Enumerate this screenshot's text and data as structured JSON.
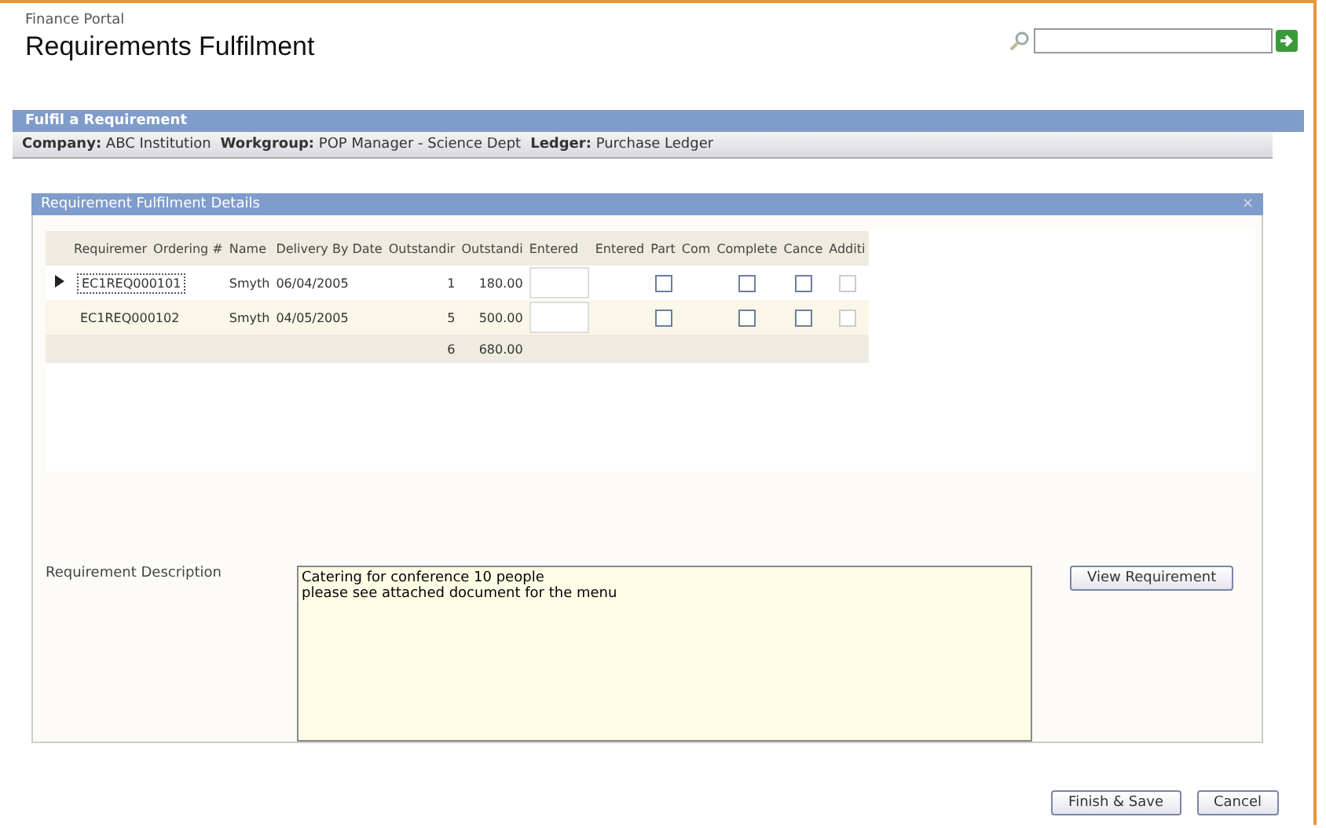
{
  "header": {
    "portal": "Finance Portal",
    "title": "Requirements Fulfilment"
  },
  "section": {
    "title": "Fulfil a Requirement",
    "info": [
      {
        "label": "Company:",
        "value": "ABC Institution"
      },
      {
        "label": "Workgroup:",
        "value": "POP Manager - Science Dept"
      },
      {
        "label": "Ledger:",
        "value": "Purchase Ledger"
      }
    ]
  },
  "panel": {
    "title": "Requirement Fulfilment Details",
    "close": "×",
    "columns": [
      "Requiremer",
      "Ordering #",
      "Name",
      "Delivery By Date",
      "Outstandir",
      "Outstandi",
      "Entered",
      "Entered",
      "Part",
      "Com",
      "Complete",
      "Cance",
      "Additi"
    ],
    "rows": [
      {
        "selected": true,
        "requirement": "EC1REQ000101",
        "name": "Smyth",
        "date": "06/04/2005",
        "qty": "1",
        "amount": "180.00",
        "part": false,
        "com": false,
        "cancel": false,
        "additional": false
      },
      {
        "selected": false,
        "requirement": "EC1REQ000102",
        "name": "Smyth",
        "date": "04/05/2005",
        "qty": "5",
        "amount": "500.00",
        "part": false,
        "com": false,
        "cancel": false,
        "additional": false
      }
    ],
    "total": {
      "qty": "6",
      "amount": "680.00"
    },
    "description_label": "Requirement Description",
    "description": "Catering for conference 10 people\nplease see attached document for the menu",
    "view_button": "View Requirement"
  },
  "buttons": [
    "Finish & Save",
    "Cancel"
  ]
}
